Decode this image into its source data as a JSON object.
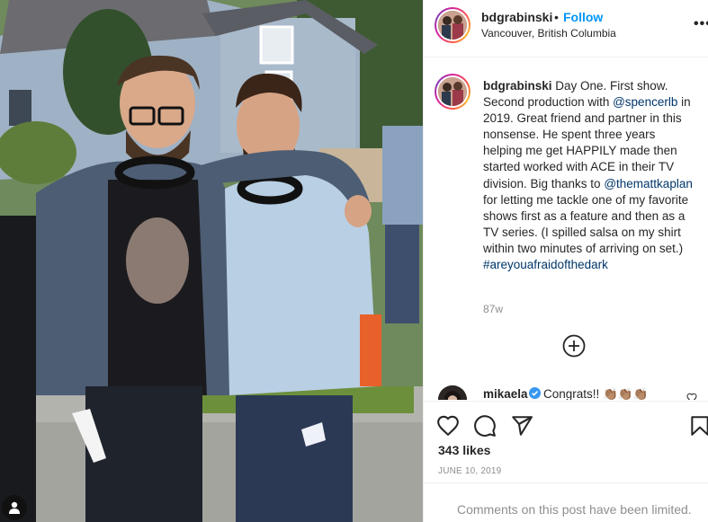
{
  "post": {
    "username": "bdgrabinski",
    "follow_label": "Follow",
    "dot": "•",
    "location": "Vancouver, British Columbia",
    "more_icon": "more-horizontal-icon"
  },
  "caption": {
    "username": "bdgrabinski",
    "text_1": " Day One. First show. Second production with ",
    "mention_1": "@spencerlb",
    "text_2": " in 2019. Great friend and partner in this nonsense. He spent three years helping me get HAPPILY made then started worked with ACE in their TV division. Big thanks to ",
    "mention_2": "@themattkaplan",
    "text_3": " for letting me tackle one of my favorite shows first as a feature and then as a TV series. (I spilled salsa on my shirt within two minutes of arriving on set.) ",
    "hashtag": "#areyouafraidofthedark",
    "time_ago": "87w"
  },
  "comment": {
    "username": "mikaela",
    "text": "Congrats!! 👏🏽👏🏽👏🏽"
  },
  "footer": {
    "likes": "343 likes",
    "date": "JUNE 10, 2019",
    "comments_limited": "Comments on this post have been limited."
  },
  "icons": [
    "heart-icon",
    "comment-icon",
    "share-icon",
    "bookmark-icon",
    "add-comment-icon",
    "verified-icon"
  ],
  "colors": {
    "accent": "#0095f6",
    "mention": "#00376b",
    "muted": "#8e8e8e",
    "divider": "#efefef"
  }
}
